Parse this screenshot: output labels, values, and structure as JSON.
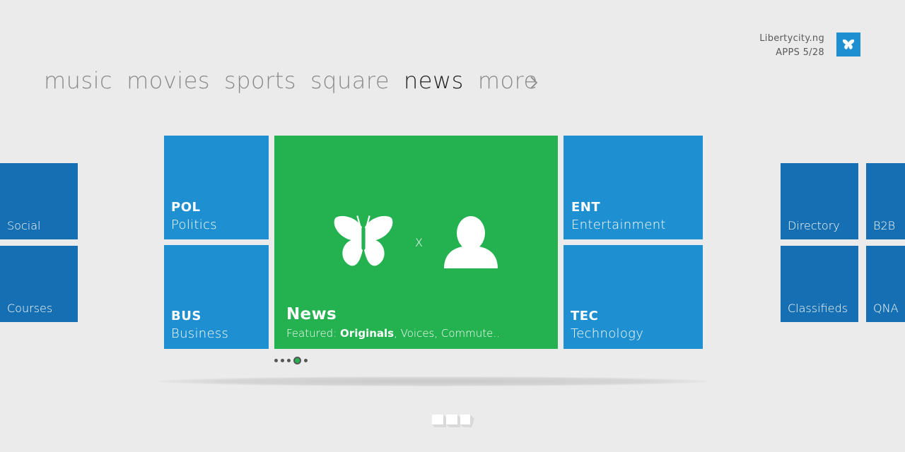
{
  "header": {
    "site_name": "Libertycity.ng",
    "apps_counter": "APPS  5/28"
  },
  "nav": {
    "items": [
      {
        "label": "music"
      },
      {
        "label": "movies"
      },
      {
        "label": "sports"
      },
      {
        "label": "square"
      },
      {
        "label": "news",
        "active": true
      },
      {
        "label": "more"
      }
    ]
  },
  "tiles": {
    "social": {
      "label": "Social"
    },
    "courses": {
      "label": "Courses"
    },
    "pol": {
      "code": "POL",
      "label": "Politics"
    },
    "bus": {
      "code": "BUS",
      "label": "Business"
    },
    "news": {
      "title": "News",
      "featured_prefix": "Featured:",
      "featured_bold": "Originals",
      "featured_rest": ",  Voices,  Commute..",
      "x_mark": "X"
    },
    "ent": {
      "code": "ENT",
      "label": "Entertainment"
    },
    "tec": {
      "code": "TEC",
      "label": "Technology"
    },
    "directory": {
      "label": "Directory"
    },
    "classifieds": {
      "label": "Classifieds"
    },
    "b2b": {
      "label": "B2B"
    },
    "qna": {
      "label": "QNA"
    }
  },
  "pager": {
    "count": 5,
    "active_index": 3
  },
  "colors": {
    "tile_blue": "#1e8fd1",
    "tile_dark_blue": "#166fb3",
    "tile_green": "#24b14f",
    "background": "#ebebeb"
  },
  "icons": [
    "butterfly-icon",
    "user-icon",
    "chevron-right-icon",
    "brand-logo-icon"
  ]
}
